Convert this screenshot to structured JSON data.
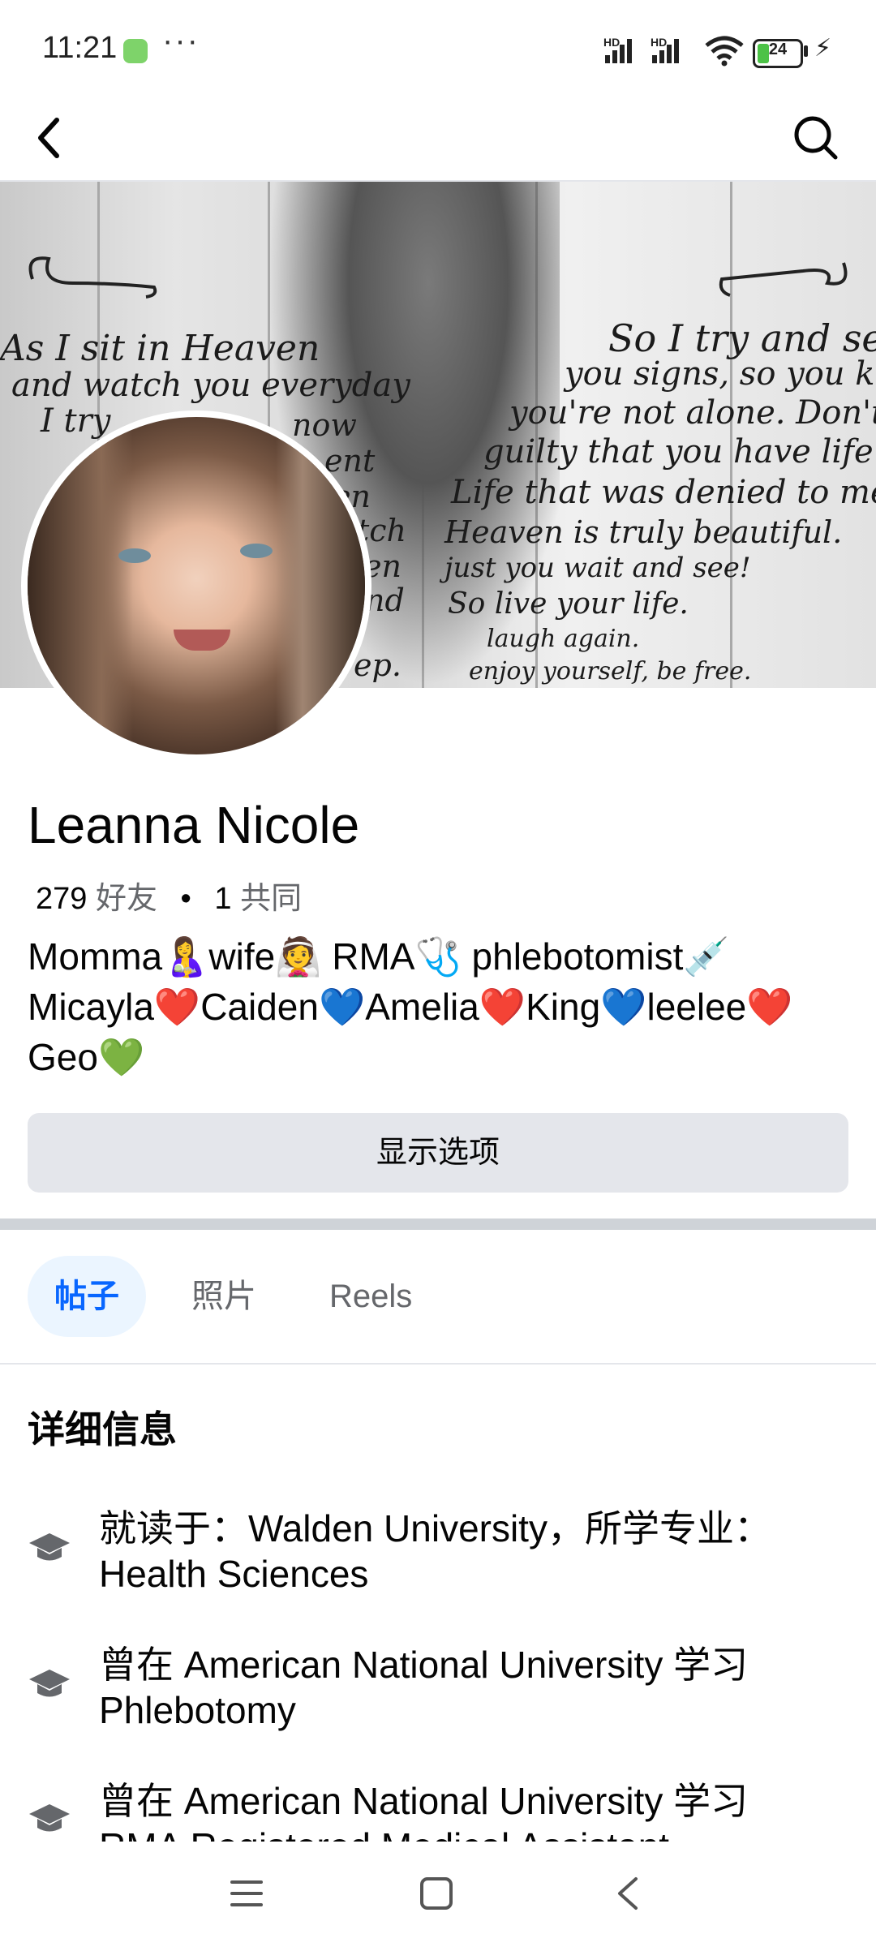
{
  "status_bar": {
    "time": "11:21",
    "dots": "···",
    "battery": "24",
    "app_icon": "wechat-icon",
    "signal_icons": [
      "hd-signal-icon",
      "hd-signal-icon",
      "wifi-icon",
      "battery-icon",
      "charging-bolt-icon"
    ]
  },
  "header": {
    "back_icon": "back-arrow-icon",
    "search_icon": "search-icon"
  },
  "cover": {
    "left_lines": [
      "As I sit in Heaven",
      "and watch you everyday",
      "I try"
    ],
    "left_fragments": [
      "now",
      "ent",
      "en",
      "tch",
      "en",
      "nd",
      "ep."
    ],
    "right_lines": [
      "So I try and send",
      "you signs, so you know",
      "you're not alone. Don't feel",
      "guilty that you have life.",
      "Life that was denied to me.",
      "Heaven is truly beautiful.",
      "just you wait and see!",
      "So live your life.",
      "laugh again.",
      "enjoy yourself, be free."
    ]
  },
  "profile": {
    "name": "Leanna Nicole",
    "friends_count": "279",
    "friends_label": "好友",
    "separator": "•",
    "mutual_count": "1",
    "mutual_label": "共同",
    "bio": "Momma🤱wife👰 RMA🩺 phlebotomist💉\nMicayla❤️Caiden💙Amelia❤️King💙leelee❤️\nGeo💚"
  },
  "actions": {
    "options_label": "显示选项"
  },
  "tabs": [
    {
      "label": "帖子",
      "active": true
    },
    {
      "label": "照片",
      "active": false
    },
    {
      "label": "Reels",
      "active": false
    }
  ],
  "details": {
    "heading": "详细信息",
    "items": [
      {
        "icon": "graduation-cap-icon",
        "line1": "就读于：Walden University，所学专业：",
        "line2": "Health Sciences"
      },
      {
        "icon": "graduation-cap-icon",
        "line1": "曾在 American National University 学习",
        "line2": "Phlebotomy"
      },
      {
        "icon": "graduation-cap-icon",
        "line1": "曾在 American National University 学习",
        "line2": "RMA Registered Medical Assistant"
      }
    ]
  },
  "navigation_bar": {
    "menu_icon": "menu-icon",
    "home_icon": "home-square-icon",
    "back_icon": "back-chevron-icon"
  },
  "colors": {
    "accent": "#0866ff",
    "tab_active_bg": "#ebf5ff",
    "button_bg": "#e4e6eb",
    "muted_text": "#65676b"
  }
}
